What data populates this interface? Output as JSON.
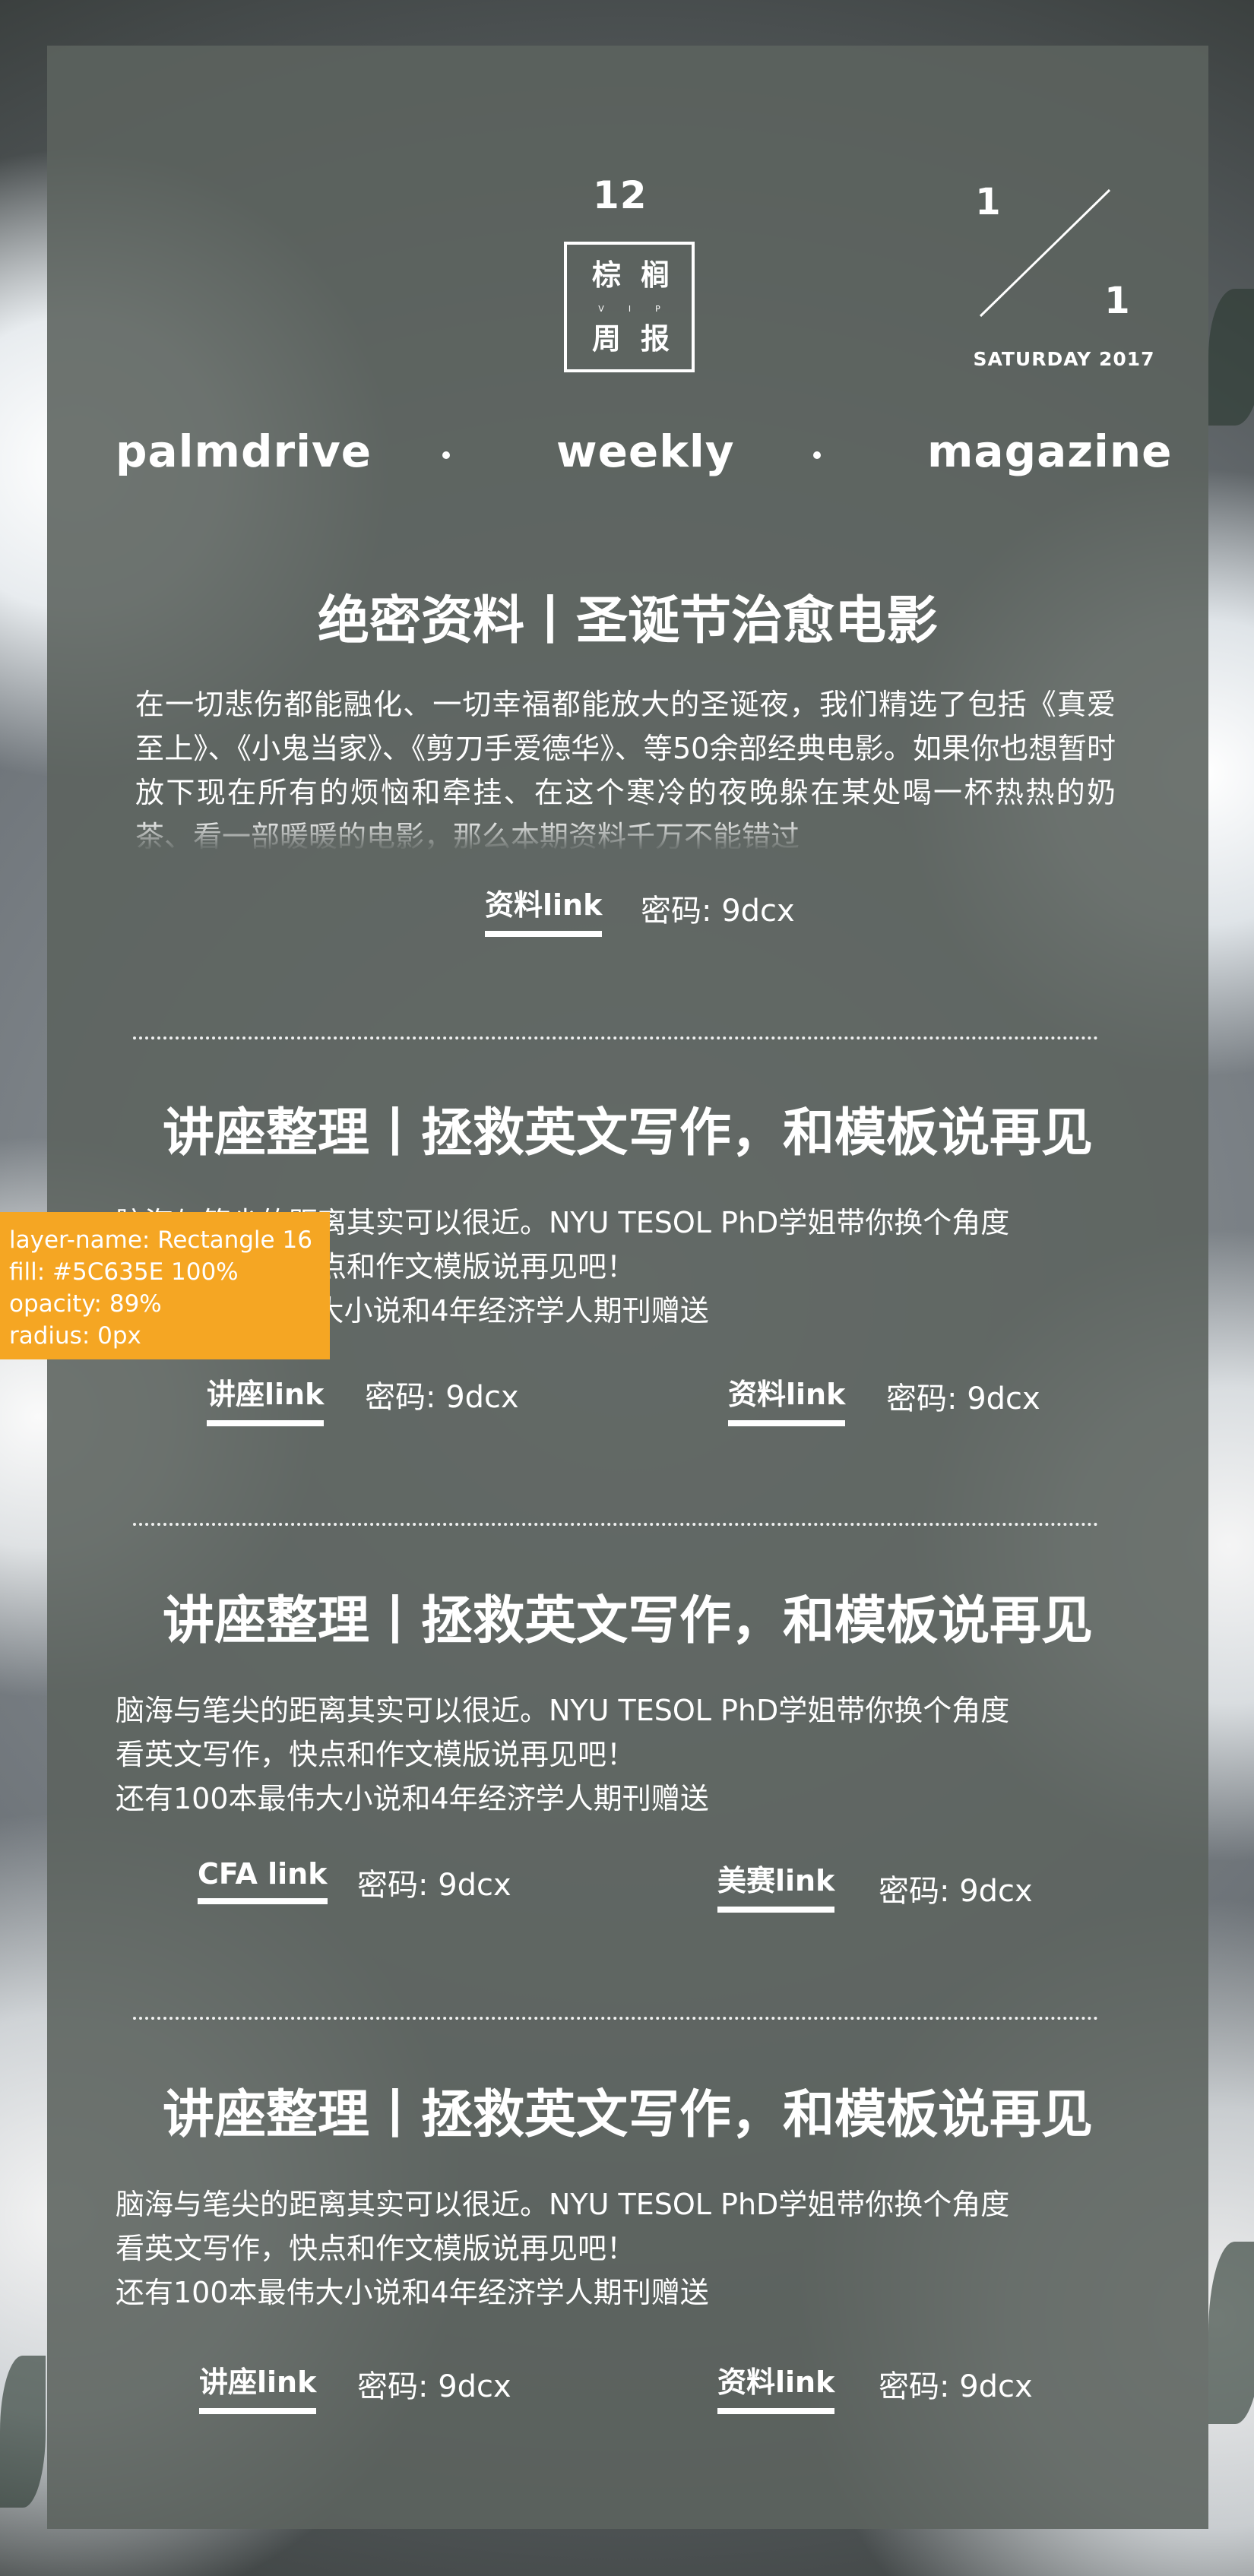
{
  "header": {
    "issue": "12",
    "logo_chars": [
      "棕",
      "榈",
      "周",
      "报"
    ],
    "logo_vip": "VIP",
    "date_top": "1",
    "date_bottom": "1",
    "weekday": "SATURDAY 2017",
    "brand": [
      "palmdrive",
      "weekly",
      "magazine"
    ]
  },
  "sections": [
    {
      "title": "绝密资料丨圣诞节治愈电影",
      "paragraph": "在一切悲伤都能融化、一切幸福都能放大的圣诞夜，我们精选了包括《真爱至上》、《小鬼当家》、《剪刀手爱德华》、等50余部经典电影。如果你也想暂时放下现在所有的烦恼和牵挂、在这个寒冷的夜晚躲在某处喝一杯热热的奶茶、看一部暖暖的电影，那么本期资料千万不能错过",
      "links": [
        {
          "label": "资料link",
          "password": "密码: 9dcx"
        }
      ]
    },
    {
      "title": "讲座整理丨拯救英文写作，和模板说再见",
      "lines": [
        "脑海与笔尖的距离其实可以很近。NYU  TESOL  PhD学姐带你换个角度",
        "看英文写作，快点和作文模版说再见吧！",
        "还有100本最伟大小说和4年经济学人期刊赠送"
      ],
      "links": [
        {
          "label": "讲座link",
          "password": "密码: 9dcx"
        },
        {
          "label": "资料link",
          "password": "密码: 9dcx"
        }
      ]
    },
    {
      "title": "讲座整理丨拯救英文写作，和模板说再见",
      "lines": [
        "脑海与笔尖的距离其实可以很近。NYU  TESOL  PhD学姐带你换个角度",
        "看英文写作，快点和作文模版说再见吧！",
        "还有100本最伟大小说和4年经济学人期刊赠送"
      ],
      "links": [
        {
          "label": "CFA link",
          "password": "密码: 9dcx"
        },
        {
          "label": "美赛link",
          "password": "密码: 9dcx"
        }
      ]
    },
    {
      "title": "讲座整理丨拯救英文写作，和模板说再见",
      "lines": [
        "脑海与笔尖的距离其实可以很近。NYU  TESOL  PhD学姐带你换个角度",
        "看英文写作，快点和作文模版说再见吧！",
        "还有100本最伟大小说和4年经济学人期刊赠送"
      ],
      "links": [
        {
          "label": "讲座link",
          "password": "密码: 9dcx"
        },
        {
          "label": "资料link",
          "password": "密码: 9dcx"
        }
      ]
    }
  ],
  "annotation": {
    "layer_name": "layer-name: Rectangle 16",
    "fill": "fill: #5C635E 100%",
    "opacity": "opacity: 89%",
    "radius": "radius: 0px"
  },
  "colors": {
    "panel": "#5C635E",
    "annotation": "#F5A623",
    "text": "#FFFFFF"
  }
}
